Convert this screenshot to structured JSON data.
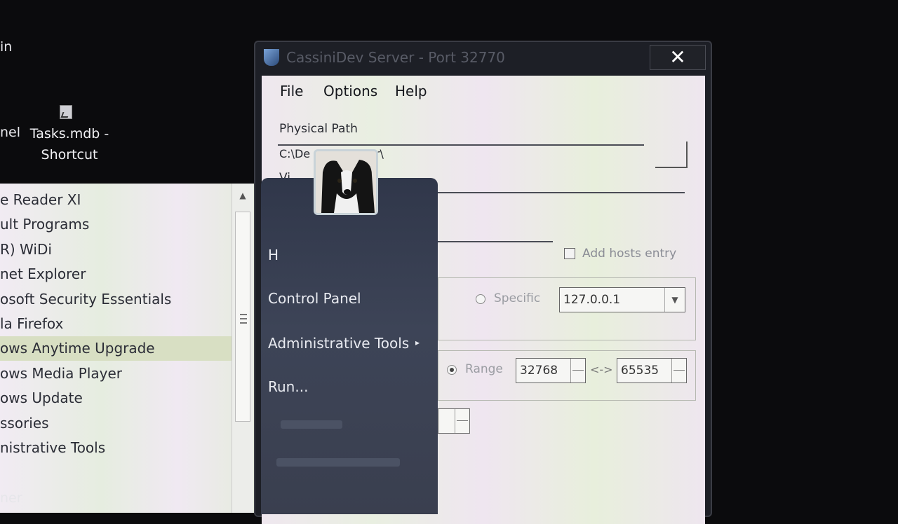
{
  "desktop": {
    "frag_in": "in",
    "frag_nel": "nel",
    "shortcut_label_line1": "Tasks.mdb -",
    "shortcut_label_line2": "Shortcut",
    "frag_bottom": "ner"
  },
  "window": {
    "title": "CassiniDev Server - Port 32770",
    "close_glyph": "✕",
    "menu": [
      "File",
      "Options",
      "Help"
    ],
    "physical_path_label": "Physical Path",
    "physical_path_value": "C:\\De                 _webviewer\\",
    "virtual_label_frag": "Vi",
    "add_hosts_label": "Add hosts entry",
    "specific_label": "Specific",
    "ip_value": "127.0.0.1",
    "range_label": "Range",
    "range_from": "32768",
    "range_sep": "<->",
    "range_to": "65535"
  },
  "start_menu": {
    "programs": [
      "e Reader XI",
      "ult Programs",
      "R) WiDi",
      "net Explorer",
      "osoft Security Essentials",
      "la Firefox",
      "ows Anytime Upgrade",
      "ows Media Player",
      "ows Update",
      "ssories",
      "nistrative Tools"
    ],
    "highlighted_index": 6,
    "right_items": {
      "user": "H",
      "control_panel": "Control Panel",
      "admin_tools": "Administrative Tools",
      "run": "Run..."
    },
    "submenu_arrow": "▸",
    "scroll_up_arrow": "▲",
    "combo_arrow": "▼"
  }
}
